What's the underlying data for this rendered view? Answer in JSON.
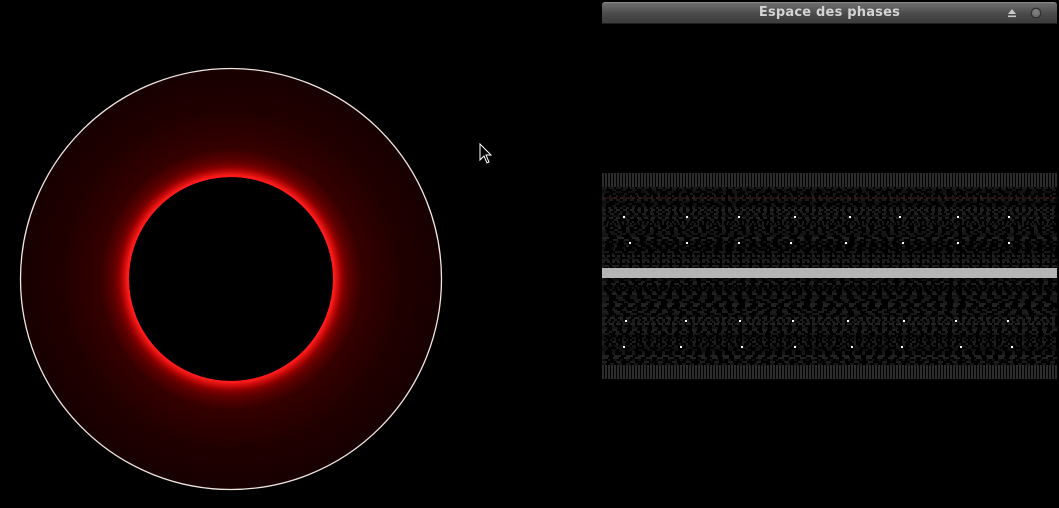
{
  "panel": {
    "title": "Espace des phases",
    "eject_icon": "eject-icon",
    "close_icon": "circle-close-icon"
  },
  "colors": {
    "ring_glow": "#ff1010",
    "ring_outer_edge": "#f0e6e0",
    "ring_fill": "#2a0000",
    "titlebar": "#4a4a4a",
    "title_text": "#d4d4d4",
    "band_highlight": "#c8c8c8",
    "band_lines": "#9a9a9a"
  },
  "cursor": {
    "icon": "arrow-cursor-icon"
  }
}
